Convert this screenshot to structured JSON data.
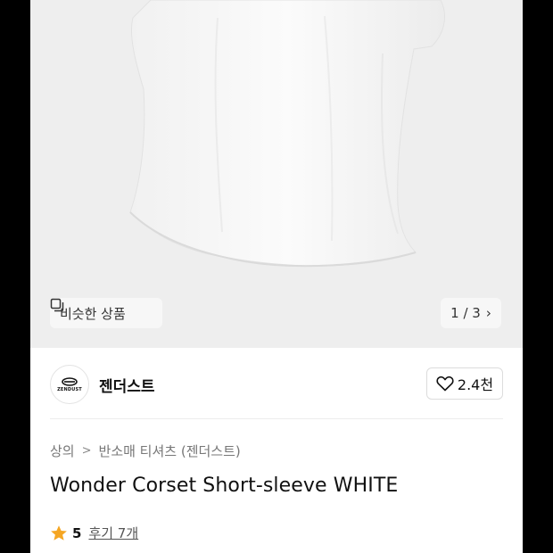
{
  "product": {
    "similar_label": "비슷한 상품",
    "pager": {
      "current": "1",
      "separator": " / ",
      "total": "3"
    }
  },
  "brand": {
    "name": "젠더스트",
    "logo_text": "ZENDUST",
    "likes": "2.4천"
  },
  "breadcrumb": [
    "상의",
    "반소매 티셔츠 (젠더스트)"
  ],
  "title": "Wonder Corset Short-sleeve WHITE",
  "rating": {
    "score": "5",
    "reviews": "후기 7개"
  },
  "colors": {
    "star": "#f5a623",
    "image_bg": "#eeeeee",
    "shirt": "#f9f9f9"
  },
  "icons": [
    "similar-products-icon",
    "chevron-right-icon",
    "heart-icon",
    "chevron-right-icon",
    "star-icon"
  ]
}
